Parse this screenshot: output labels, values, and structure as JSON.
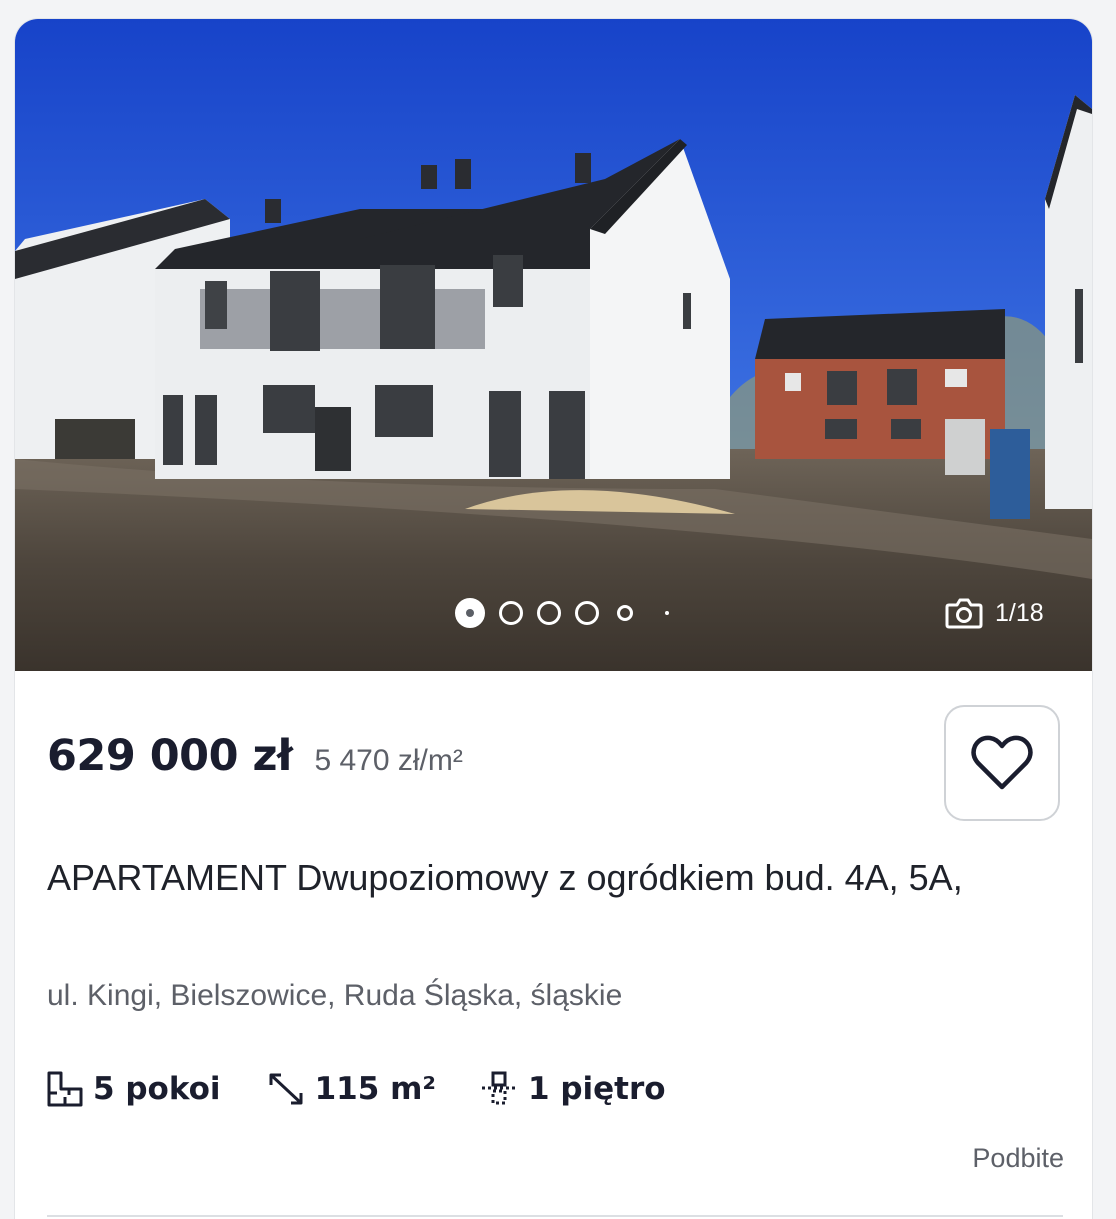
{
  "listing": {
    "price": "629 000 zł",
    "price_per_m2": "5 470 zł/m²",
    "title": "APARTAMENT Dwupoziomowy z ogródkiem bud. 4A, 5A,",
    "address": "ul. Kingi, Bielszowice, Ruda Śląska, śląskie",
    "features": {
      "rooms": "5 pokoi",
      "area": "115 m²",
      "floor": "1 piętro"
    },
    "badge": "Podbite"
  },
  "gallery": {
    "counter": "1/18",
    "current_index": 1,
    "total": 18
  },
  "icons": {
    "camera": "camera-icon",
    "favorite": "heart-icon",
    "rooms": "floor-plan-icon",
    "area": "area-arrows-icon",
    "floor": "stairs-icon"
  },
  "colors": {
    "text_primary": "#1a1d2e",
    "text_secondary": "#5d6068",
    "border": "#cfd2d6"
  }
}
